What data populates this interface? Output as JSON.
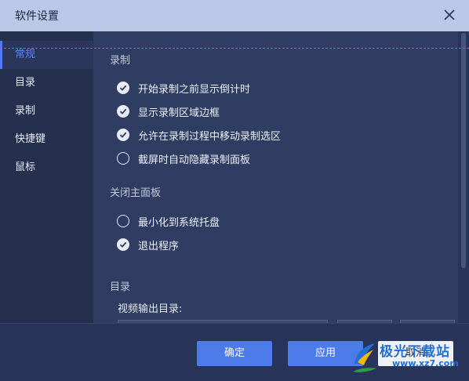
{
  "window": {
    "title": "软件设置"
  },
  "sidebar": {
    "items": [
      {
        "label": "常规",
        "active": true
      },
      {
        "label": "目录",
        "active": false
      },
      {
        "label": "录制",
        "active": false
      },
      {
        "label": "快捷键",
        "active": false
      },
      {
        "label": "鼠标",
        "active": false
      }
    ]
  },
  "sections": {
    "record": {
      "title": "录制",
      "options": [
        {
          "label": "开始录制之前显示倒计时",
          "checked": true
        },
        {
          "label": "显示录制区域边框",
          "checked": true
        },
        {
          "label": "允许在录制过程中移动录制选区",
          "checked": true
        },
        {
          "label": "截屏时自动隐藏录制面板",
          "checked": false
        }
      ]
    },
    "close_panel": {
      "title": "关闭主面板",
      "options": [
        {
          "label": "最小化到系统托盘",
          "checked": false
        },
        {
          "label": "退出程序",
          "checked": true
        }
      ]
    },
    "directory": {
      "title": "目录",
      "video_output_label": "视频输出目录:"
    }
  },
  "footer": {
    "ok_label": "确定",
    "apply_label": "应用",
    "cancel_label": "取消"
  },
  "watermark": {
    "text": "极光下载站",
    "url": "www.xz7.com"
  },
  "colors": {
    "accent": "#4e7bea",
    "sidebar_active": "#5b86ff",
    "background": "#2f3d63",
    "titlebar": "#b8c8e6"
  }
}
